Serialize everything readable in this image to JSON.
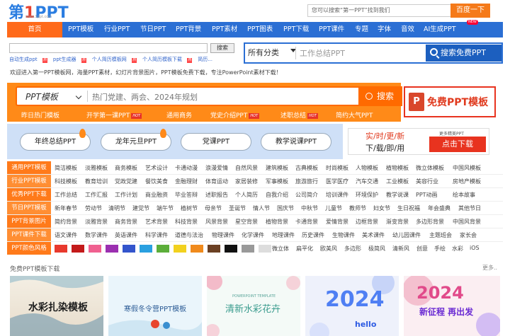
{
  "logo": {
    "main_a": "第",
    "main_b": "1",
    "main_c": "PPT",
    "sub": "www.1ppt.com"
  },
  "top_search": {
    "placeholder": "您可以搜索“第一PPT”找到我们",
    "button": "百度一下"
  },
  "nav": [
    "首页",
    "PPT模板",
    "行业PPT",
    "节日PPT",
    "PPT背景",
    "PPT素材",
    "PPT图表",
    "PPT下载",
    "PPT课件",
    "专题",
    "字体",
    "音效",
    "AI生成PPT"
  ],
  "nav_badge": "NEW",
  "mini": {
    "button": "搜索",
    "links": [
      "自动生成ppt",
      "ppt生成器",
      "个人简历模板网",
      "个人简历模板下载",
      "简历..."
    ]
  },
  "search": {
    "category": "所有分类",
    "placeholder": "工作总结PPT",
    "button": "搜索免费PPT"
  },
  "welcome": "欢迎进入第一PPT模板网，海量PPT素材，幻灯片背景图片，PPT模板免费下载，专注PowerPoint素材下载！",
  "banner": {
    "select": "PPT模板",
    "placeholder": "热门党建、两会、2024年规划",
    "button": "搜索",
    "links": [
      "昨日热门模板",
      "开学第一课PPT",
      "通用商务",
      "党史介绍PPT",
      "述职总结",
      "简约大气PPT"
    ],
    "hot": "HOT"
  },
  "free": {
    "icon": "P",
    "label": "免费PPT模板"
  },
  "pills": [
    "年终总结PPT",
    "龙年元旦PPT",
    "党课PPT",
    "教学说课PPT"
  ],
  "promo": {
    "l1": "实/时/更/新",
    "l2": "下/载/即/用",
    "small": "更多精美PPT",
    "button": "点击下载"
  },
  "grid": [
    {
      "h": "通用PPT模板",
      "items": [
        "简洁模板",
        "淡雅模板",
        "商务模板",
        "艺术设计",
        "卡通动漫",
        "浪漫爱情",
        "自然风景",
        "建筑模板",
        "古典模板",
        "时尚模板",
        "人物模板",
        "植物模板",
        "微立体模板",
        "中国风模板"
      ]
    },
    {
      "h": "行业PPT模板",
      "items": [
        "科技模板",
        "教育培训",
        "党政党建",
        "餐饮美食",
        "金融理财",
        "体育运动",
        "家居装修",
        "军事模板",
        "旅游旅行",
        "医学医疗",
        "汽车交通",
        "工业模板",
        "美容行业",
        "房地产模板"
      ]
    },
    {
      "h": "优秀PPT下载",
      "items": [
        "工作总结",
        "工作汇报",
        "工作计划",
        "商业融资",
        "毕业答辩",
        "述职报告",
        "个人简历",
        "自我介绍",
        "公司简介",
        "培训课件",
        "环境保护",
        "教学说课",
        "PPT动画",
        "绘本故事"
      ]
    },
    {
      "h": "节日PPT模板",
      "items": [
        "新年春节",
        "劳动节",
        "清明节",
        "建党节",
        "端午节",
        "植树节",
        "母亲节",
        "圣诞节",
        "情人节",
        "国庆节",
        "中秋节",
        "儿童节",
        "教师节",
        "妇女节",
        "生日祝福",
        "年会盛典",
        "其他节日"
      ]
    },
    {
      "h": "PPT背景图片",
      "items": [
        "简约背景",
        "淡雅背景",
        "商务背景",
        "艺术背景",
        "科技背景",
        "风景背景",
        "星空背景",
        "植物背景",
        "卡通背景",
        "爱情背景",
        "边框背景",
        "渐变背景",
        "多边形背景",
        "中国风背景"
      ]
    },
    {
      "h": "PPT课件下载",
      "items": [
        "语文课件",
        "数学课件",
        "英语课件",
        "科学课件",
        "道德与法治",
        "物理课件",
        "化学课件",
        "地理课件",
        "历史课件",
        "生物课件",
        "美术课件",
        "幼儿园课件",
        "主题班会",
        "家长会"
      ]
    },
    {
      "h": "PPT颜色风格",
      "items": [
        "微立体",
        "扁平化",
        "欧美风",
        "多边形",
        "极简风",
        "清新风",
        "创意",
        "手绘",
        "水彩",
        "iOS"
      ]
    }
  ],
  "swatch_colors": [
    "#e8392d",
    "#c31a1a",
    "#f06090",
    "#9b2fb0",
    "#3355cc",
    "#2aa0e0",
    "#5cae3a",
    "#f2d11f",
    "#f08a1c",
    "#6b4023",
    "#111111",
    "#999999",
    "#dddddd"
  ],
  "section": {
    "title": "免费PPT模板下载",
    "more": "更多.."
  },
  "thumbs": [
    {
      "title": "水彩扎染模板"
    },
    {
      "title": "寒假冬令营PPT模板"
    },
    {
      "title": "清新水彩花卉",
      "sub": "POWERPOINT TEMPLATE"
    },
    {
      "title": "2024",
      "sub": "hello"
    },
    {
      "title": "新征程 再出发",
      "sub": "2024"
    }
  ]
}
